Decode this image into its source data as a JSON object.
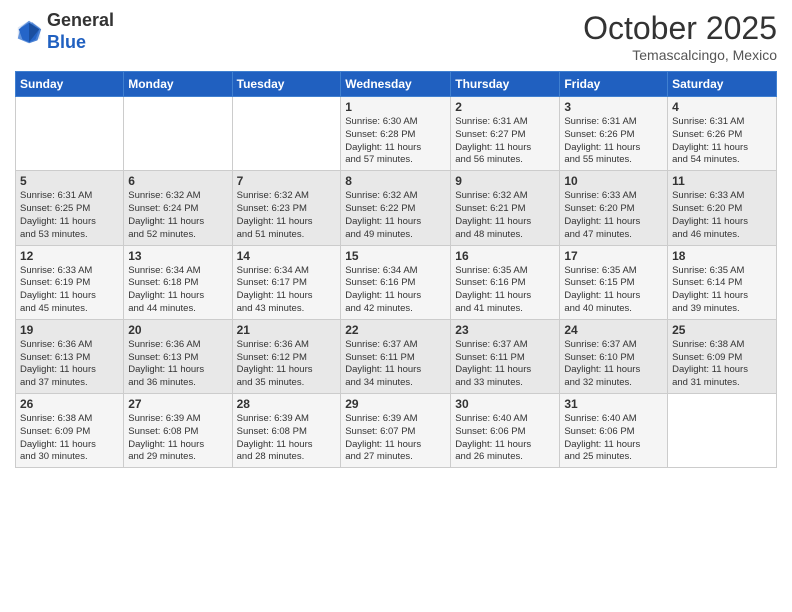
{
  "header": {
    "logo_general": "General",
    "logo_blue": "Blue",
    "month_title": "October 2025",
    "location": "Temascalcingo, Mexico"
  },
  "days_of_week": [
    "Sunday",
    "Monday",
    "Tuesday",
    "Wednesday",
    "Thursday",
    "Friday",
    "Saturday"
  ],
  "weeks": [
    [
      {
        "day": "",
        "info": ""
      },
      {
        "day": "",
        "info": ""
      },
      {
        "day": "",
        "info": ""
      },
      {
        "day": "1",
        "info": "Sunrise: 6:30 AM\nSunset: 6:28 PM\nDaylight: 11 hours\nand 57 minutes."
      },
      {
        "day": "2",
        "info": "Sunrise: 6:31 AM\nSunset: 6:27 PM\nDaylight: 11 hours\nand 56 minutes."
      },
      {
        "day": "3",
        "info": "Sunrise: 6:31 AM\nSunset: 6:26 PM\nDaylight: 11 hours\nand 55 minutes."
      },
      {
        "day": "4",
        "info": "Sunrise: 6:31 AM\nSunset: 6:26 PM\nDaylight: 11 hours\nand 54 minutes."
      }
    ],
    [
      {
        "day": "5",
        "info": "Sunrise: 6:31 AM\nSunset: 6:25 PM\nDaylight: 11 hours\nand 53 minutes."
      },
      {
        "day": "6",
        "info": "Sunrise: 6:32 AM\nSunset: 6:24 PM\nDaylight: 11 hours\nand 52 minutes."
      },
      {
        "day": "7",
        "info": "Sunrise: 6:32 AM\nSunset: 6:23 PM\nDaylight: 11 hours\nand 51 minutes."
      },
      {
        "day": "8",
        "info": "Sunrise: 6:32 AM\nSunset: 6:22 PM\nDaylight: 11 hours\nand 49 minutes."
      },
      {
        "day": "9",
        "info": "Sunrise: 6:32 AM\nSunset: 6:21 PM\nDaylight: 11 hours\nand 48 minutes."
      },
      {
        "day": "10",
        "info": "Sunrise: 6:33 AM\nSunset: 6:20 PM\nDaylight: 11 hours\nand 47 minutes."
      },
      {
        "day": "11",
        "info": "Sunrise: 6:33 AM\nSunset: 6:20 PM\nDaylight: 11 hours\nand 46 minutes."
      }
    ],
    [
      {
        "day": "12",
        "info": "Sunrise: 6:33 AM\nSunset: 6:19 PM\nDaylight: 11 hours\nand 45 minutes."
      },
      {
        "day": "13",
        "info": "Sunrise: 6:34 AM\nSunset: 6:18 PM\nDaylight: 11 hours\nand 44 minutes."
      },
      {
        "day": "14",
        "info": "Sunrise: 6:34 AM\nSunset: 6:17 PM\nDaylight: 11 hours\nand 43 minutes."
      },
      {
        "day": "15",
        "info": "Sunrise: 6:34 AM\nSunset: 6:16 PM\nDaylight: 11 hours\nand 42 minutes."
      },
      {
        "day": "16",
        "info": "Sunrise: 6:35 AM\nSunset: 6:16 PM\nDaylight: 11 hours\nand 41 minutes."
      },
      {
        "day": "17",
        "info": "Sunrise: 6:35 AM\nSunset: 6:15 PM\nDaylight: 11 hours\nand 40 minutes."
      },
      {
        "day": "18",
        "info": "Sunrise: 6:35 AM\nSunset: 6:14 PM\nDaylight: 11 hours\nand 39 minutes."
      }
    ],
    [
      {
        "day": "19",
        "info": "Sunrise: 6:36 AM\nSunset: 6:13 PM\nDaylight: 11 hours\nand 37 minutes."
      },
      {
        "day": "20",
        "info": "Sunrise: 6:36 AM\nSunset: 6:13 PM\nDaylight: 11 hours\nand 36 minutes."
      },
      {
        "day": "21",
        "info": "Sunrise: 6:36 AM\nSunset: 6:12 PM\nDaylight: 11 hours\nand 35 minutes."
      },
      {
        "day": "22",
        "info": "Sunrise: 6:37 AM\nSunset: 6:11 PM\nDaylight: 11 hours\nand 34 minutes."
      },
      {
        "day": "23",
        "info": "Sunrise: 6:37 AM\nSunset: 6:11 PM\nDaylight: 11 hours\nand 33 minutes."
      },
      {
        "day": "24",
        "info": "Sunrise: 6:37 AM\nSunset: 6:10 PM\nDaylight: 11 hours\nand 32 minutes."
      },
      {
        "day": "25",
        "info": "Sunrise: 6:38 AM\nSunset: 6:09 PM\nDaylight: 11 hours\nand 31 minutes."
      }
    ],
    [
      {
        "day": "26",
        "info": "Sunrise: 6:38 AM\nSunset: 6:09 PM\nDaylight: 11 hours\nand 30 minutes."
      },
      {
        "day": "27",
        "info": "Sunrise: 6:39 AM\nSunset: 6:08 PM\nDaylight: 11 hours\nand 29 minutes."
      },
      {
        "day": "28",
        "info": "Sunrise: 6:39 AM\nSunset: 6:08 PM\nDaylight: 11 hours\nand 28 minutes."
      },
      {
        "day": "29",
        "info": "Sunrise: 6:39 AM\nSunset: 6:07 PM\nDaylight: 11 hours\nand 27 minutes."
      },
      {
        "day": "30",
        "info": "Sunrise: 6:40 AM\nSunset: 6:06 PM\nDaylight: 11 hours\nand 26 minutes."
      },
      {
        "day": "31",
        "info": "Sunrise: 6:40 AM\nSunset: 6:06 PM\nDaylight: 11 hours\nand 25 minutes."
      },
      {
        "day": "",
        "info": ""
      }
    ]
  ]
}
